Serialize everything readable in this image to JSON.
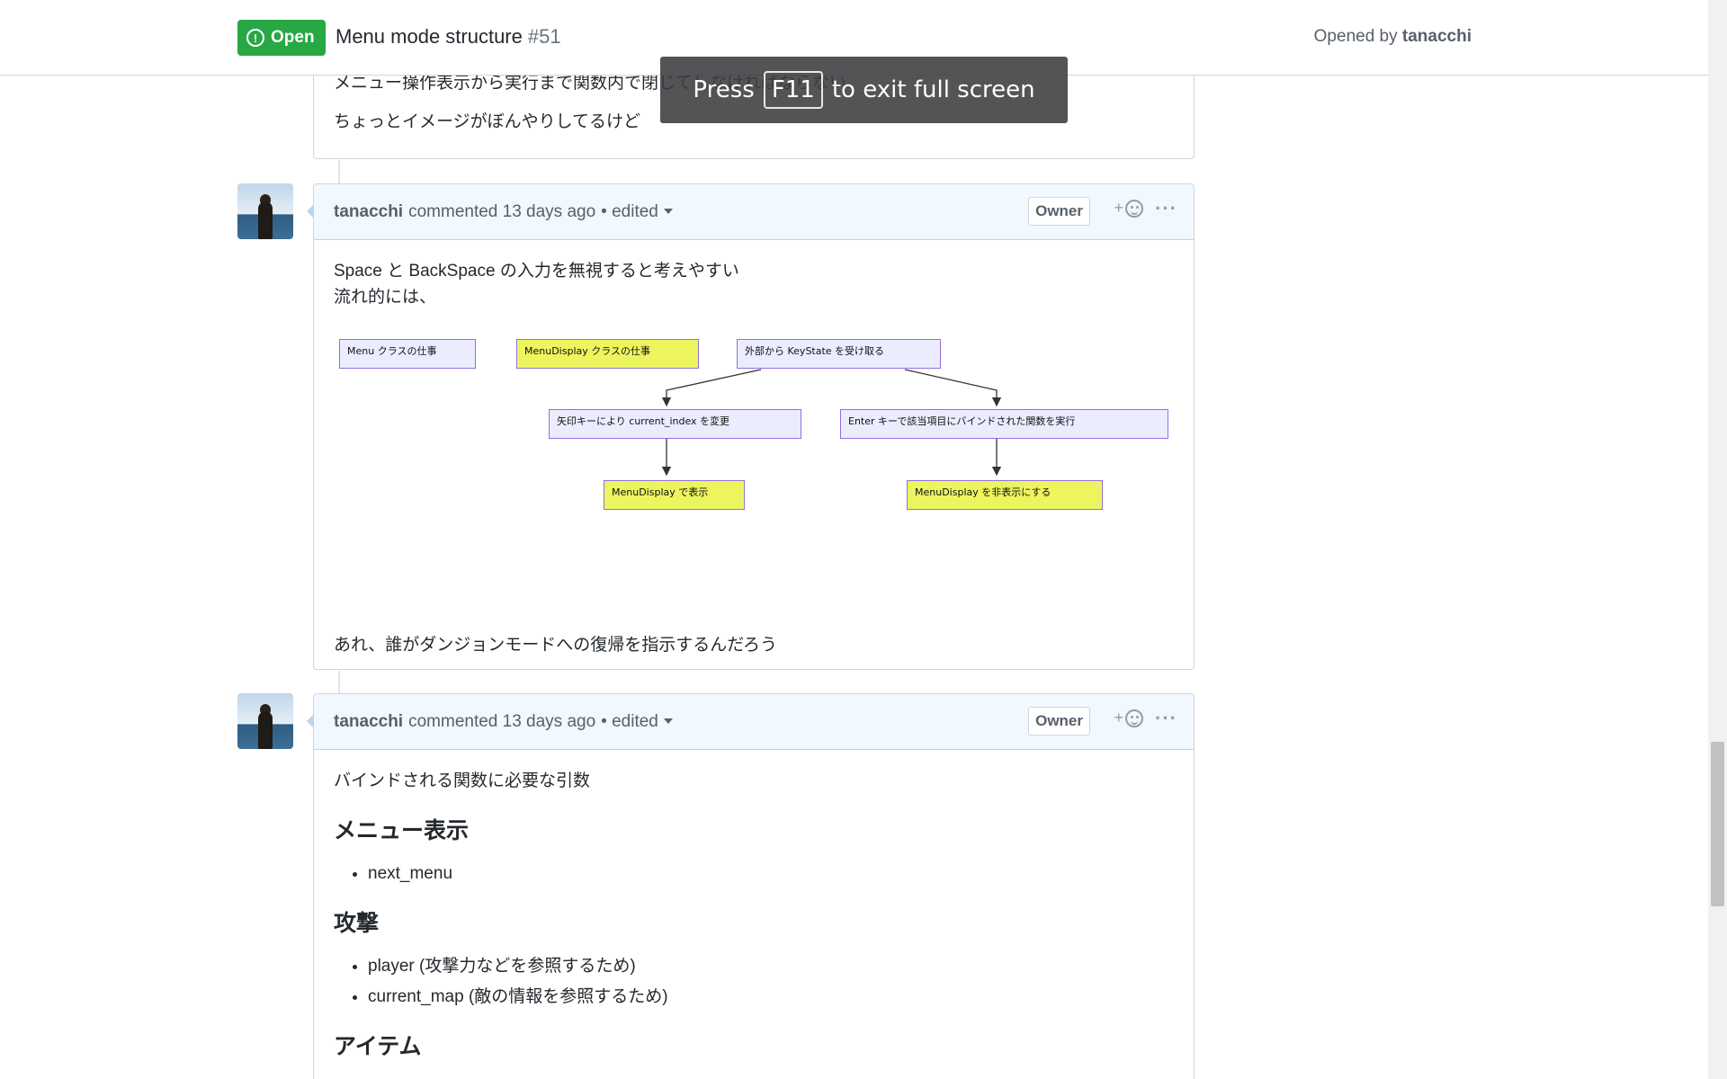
{
  "header": {
    "state": "Open",
    "title": "Menu mode structure",
    "number": "#51",
    "opened_by_prefix": "Opened by",
    "opened_by_user": "tanacchi"
  },
  "fullscreen_notice": {
    "before": "Press",
    "key": "F11",
    "after": "to exit full screen"
  },
  "prev_comment": {
    "line1": "メニュー操作表示から実行まで関数内で閉じてしなければならない",
    "line2": "ちょっとイメージがぼんやりしてるけど"
  },
  "comment1": {
    "author": "tanacchi",
    "meta": "commented 13 days ago",
    "edited": "• edited",
    "badge": "Owner",
    "reaction": "+",
    "more": "···",
    "line1": "Space と BackSpace の入力を無視すると考えやすい",
    "line2": "流れ的には、",
    "diagram": {
      "nodes": {
        "menu_class": "Menu クラスの仕事",
        "menudisplay_class": "MenuDisplay クラスの仕事",
        "keystate": "外部から KeyState を受け取る",
        "arrow_key": "矢印キーにより current_index を変更",
        "enter_key": "Enter キーで該当項目にバインドされた関数を実行",
        "display_show": "MenuDisplay で表示",
        "display_hide": "MenuDisplay を非表示にする"
      }
    },
    "footer": "あれ、誰がダンジョンモードへの復帰を指示するんだろう"
  },
  "comment2": {
    "author": "tanacchi",
    "meta": "commented 13 days ago",
    "edited": "• edited",
    "badge": "Owner",
    "reaction": "+",
    "more": "···",
    "intro": "バインドされる関数に必要な引数",
    "sections": [
      {
        "heading": "メニュー表示",
        "items": [
          "next_menu"
        ]
      },
      {
        "heading": "攻撃",
        "items": [
          "player (攻撃力などを参照するため)",
          "current_map (敵の情報を参照するため)"
        ]
      }
    ],
    "next_heading": "アイテム"
  }
}
